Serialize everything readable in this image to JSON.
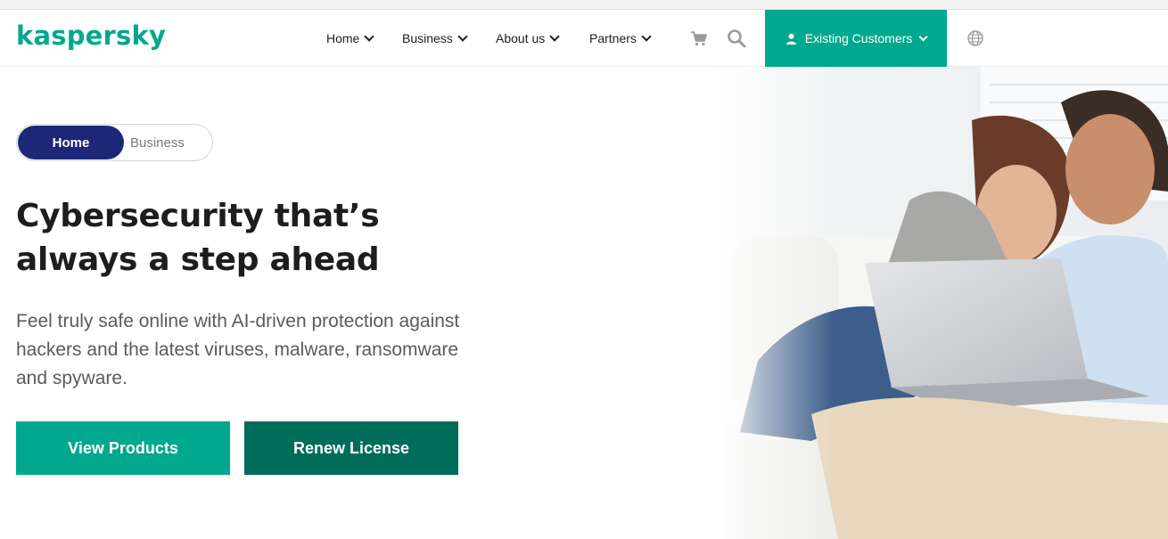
{
  "brand": {
    "logo_text": "kaspersky",
    "accent": "#00a88e",
    "navy": "#1d2778",
    "dark_green": "#006d5b"
  },
  "nav": {
    "items": [
      {
        "label": "Home"
      },
      {
        "label": "Business"
      },
      {
        "label": "About us"
      },
      {
        "label": "Partners"
      }
    ],
    "cart_icon": "cart-icon",
    "search_icon": "search-icon",
    "existing_customers": "Existing Customers",
    "globe_icon": "globe-icon"
  },
  "toggle": {
    "home": "Home",
    "business": "Business",
    "selected": "Home"
  },
  "hero": {
    "headline_line1": "Cybersecurity that’s",
    "headline_line2": "always a step ahead",
    "subtext": "Feel truly safe online with AI-driven protection against hackers and the latest viruses, malware, ransomware and spyware.",
    "view_products": "View Products",
    "renew_license": "Renew License"
  }
}
